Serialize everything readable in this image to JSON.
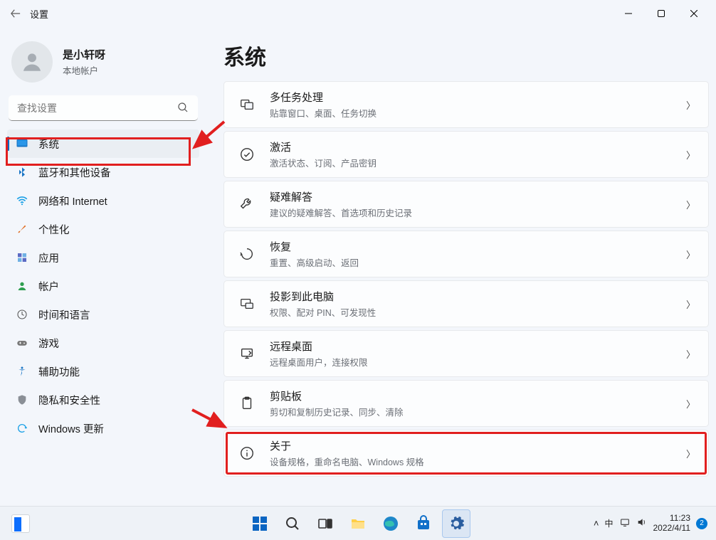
{
  "window": {
    "title": "设置"
  },
  "account": {
    "name": "是小轩呀",
    "type": "本地帐户"
  },
  "search": {
    "placeholder": "查找设置"
  },
  "sidebar": {
    "items": [
      {
        "label": "系统"
      },
      {
        "label": "蓝牙和其他设备"
      },
      {
        "label": "网络和 Internet"
      },
      {
        "label": "个性化"
      },
      {
        "label": "应用"
      },
      {
        "label": "帐户"
      },
      {
        "label": "时间和语言"
      },
      {
        "label": "游戏"
      },
      {
        "label": "辅助功能"
      },
      {
        "label": "隐私和安全性"
      },
      {
        "label": "Windows 更新"
      }
    ]
  },
  "main": {
    "heading": "系统",
    "cards": [
      {
        "title": "多任务处理",
        "desc": "贴靠窗口、桌面、任务切换"
      },
      {
        "title": "激活",
        "desc": "激活状态、订阅、产品密钥"
      },
      {
        "title": "疑难解答",
        "desc": "建议的疑难解答、首选项和历史记录"
      },
      {
        "title": "恢复",
        "desc": "重置、高级启动、返回"
      },
      {
        "title": "投影到此电脑",
        "desc": "权限、配对 PIN、可发现性"
      },
      {
        "title": "远程桌面",
        "desc": "远程桌面用户，连接权限"
      },
      {
        "title": "剪贴板",
        "desc": "剪切和复制历史记录、同步、清除"
      },
      {
        "title": "关于",
        "desc": "设备规格，重命名电脑、Windows 规格"
      }
    ]
  },
  "taskbar": {
    "tray": {
      "ime": "中",
      "time": "11:23",
      "date": "2022/4/11",
      "notif": "2",
      "chevron": "˄"
    }
  }
}
